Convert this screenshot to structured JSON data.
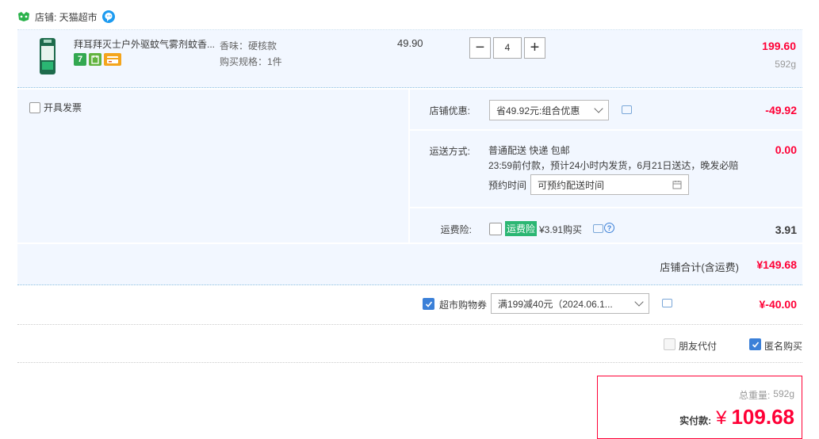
{
  "shop": {
    "label": "店铺: 天猫超市"
  },
  "item": {
    "title": "拜耳拜灭士户外驱蚊气雾剂蚊香...",
    "sku_flavor": "香味：硬核款",
    "sku_spec": "购买规格：1件",
    "unit_price": "49.90",
    "quantity": "4",
    "minus": "−",
    "plus": "+",
    "subtotal": "199.60",
    "weight": "592g",
    "icon_seven": "7"
  },
  "invoice": {
    "label": "开具发票"
  },
  "discount": {
    "label": "店铺优惠:",
    "selected": "省49.92元:组合优惠",
    "amount": "-49.92"
  },
  "shipping": {
    "label": "运送方式:",
    "method": "普通配送 快递 包邮",
    "note": "23:59前付款，预计24小时内发货，6月21日送达，晚发必赔",
    "appoint_label": "预约时间",
    "appoint_value": "可预约配送时间",
    "amount": "0.00"
  },
  "insurance": {
    "label": "运费险:",
    "tag": "运费险",
    "price": "¥3.91购买",
    "amount": "3.91"
  },
  "shop_total": {
    "label": "店铺合计(含运费)",
    "amount": "¥149.68"
  },
  "coupon": {
    "label": "超市购物券",
    "selected": "满199减40元（2024.06.1...",
    "amount": "¥-40.00"
  },
  "options": {
    "friend_pay": "朋友代付",
    "anonymous": "匿名购买"
  },
  "payment": {
    "weight_label": "总重量:",
    "weight": "592g",
    "paid_label": "实付款:",
    "currency": "¥",
    "amount": "109.68"
  },
  "colors": {
    "accent_red": "#ff0036",
    "row_bg": "#f2f7ff",
    "checkbox_blue": "#3b80d8"
  }
}
